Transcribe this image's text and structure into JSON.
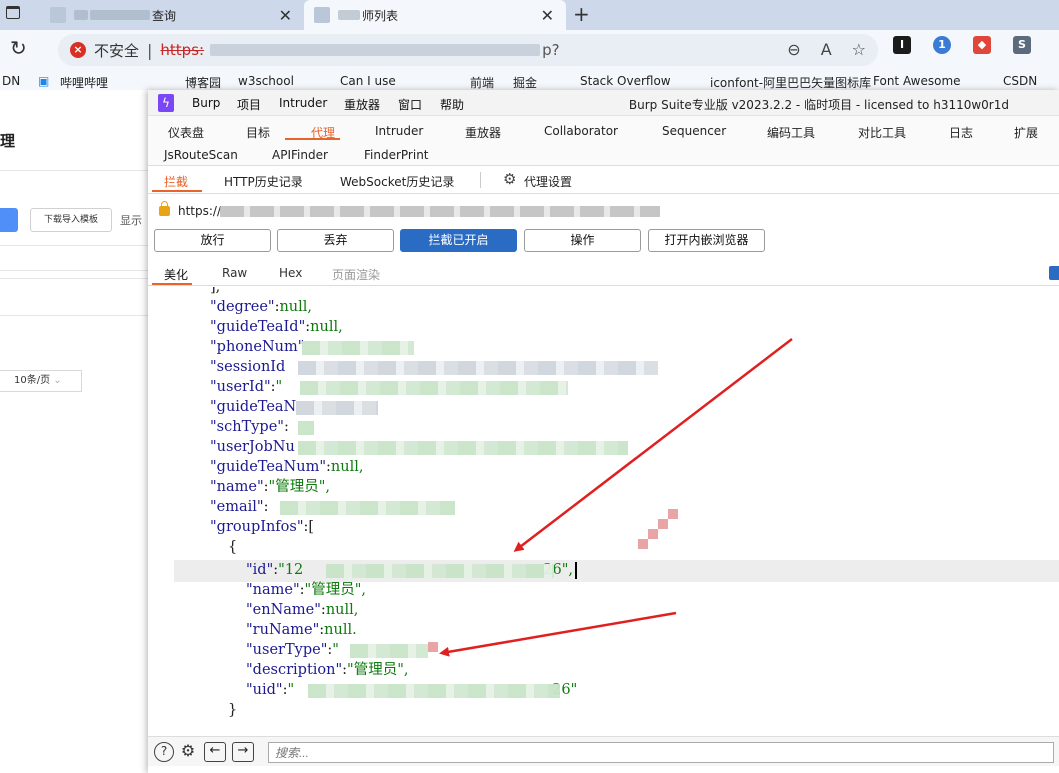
{
  "browser": {
    "tabs": [
      {
        "title": "查询",
        "active": false
      },
      {
        "title": "师列表",
        "active": true
      }
    ],
    "security_label": "不安全",
    "url_scheme": "https:",
    "url_tail": "p?",
    "bookmarks": [
      "DN",
      "哔哩哔哩",
      "博客园",
      "w3school",
      "Can I use",
      "前端",
      "掘金",
      "Stack Overflow",
      "iconfont-阿里巴巴矢量图标库",
      "Font Awesome",
      "CSDN"
    ],
    "extension_badge": "1"
  },
  "webpage": {
    "title": "理",
    "download_button": "下载导入模板",
    "show_text": "显示",
    "page_size": "10条/页"
  },
  "burp": {
    "logo": "Burp",
    "menu": [
      "Burp",
      "项目",
      "Intruder",
      "重放器",
      "窗口",
      "帮助"
    ],
    "title": "Burp Suite专业版  v2023.2.2 - 临时项目 - licensed to h3110w0r1d",
    "main_tabs": [
      "仪表盘",
      "目标",
      "代理",
      "Intruder",
      "重放器",
      "Collaborator",
      "Sequencer",
      "编码工具",
      "对比工具",
      "日志",
      "扩展"
    ],
    "main_tabs_row2": [
      "JsRouteScan",
      "APIFinder",
      "FinderPrint"
    ],
    "active_main_tab": "代理",
    "sub_tabs": [
      "拦截",
      "HTTP历史记录",
      "WebSocket历史记录"
    ],
    "proxy_settings": "代理设置",
    "request_url": "https://",
    "buttons": {
      "forward": "放行",
      "drop": "丢弃",
      "intercept": "拦截已开启",
      "action": "操作",
      "open_browser": "打开内嵌浏览器"
    },
    "view_tabs": [
      "美化",
      "Raw",
      "Hex",
      "页面渲染"
    ],
    "search_placeholder": "搜索...",
    "code": {
      "l0": "],",
      "l1_key": "\"degree\"",
      "l1_val": "null,",
      "l2_key": "\"guideTeaId\"",
      "l2_val": "null,",
      "l3_key": "\"phoneNum\"",
      "l4_key": "\"sessionId",
      "l5_key": "\"userId\"",
      "l5_val": "\"",
      "l6_key": "\"guideTeaN",
      "l7_key": "\"schType\"",
      "l7_val": ":",
      "l8_key": "\"userJobNu",
      "l9_key": "\"guideTeaNum\"",
      "l9_val": "null,",
      "l10_key": "\"name\"",
      "l10_val": "\"管理员\",",
      "l11_key": "\"email\"",
      "l11_val": ":",
      "l12_key": "\"groupInfos\"",
      "l12_val": "[",
      "l13": "{",
      "l14_key": "\"id\"",
      "l14_val_head": "\"12",
      "l14_val_tail": "26\",",
      "l15_key": "\"name\"",
      "l15_val": "\"管理员\",",
      "l16_key": "\"enName\"",
      "l16_val": "null,",
      "l17_key": "\"ruName\"",
      "l17_val": "null.",
      "l18_key": "\"userType\"",
      "l18_val": "\"",
      "l19_key": "\"description\"",
      "l19_val": "\"管理员\",",
      "l20_key": "\"uid\"",
      "l20_val_head": "\"",
      "l20_val_tail": "26\"",
      "l21": "}"
    }
  },
  "colors": {
    "accent": "#e8642a",
    "primary_button": "#2a6bc4",
    "json_key": "#1d1a8f",
    "json_value": "#0e7a0e",
    "arrow": "#e02020"
  }
}
